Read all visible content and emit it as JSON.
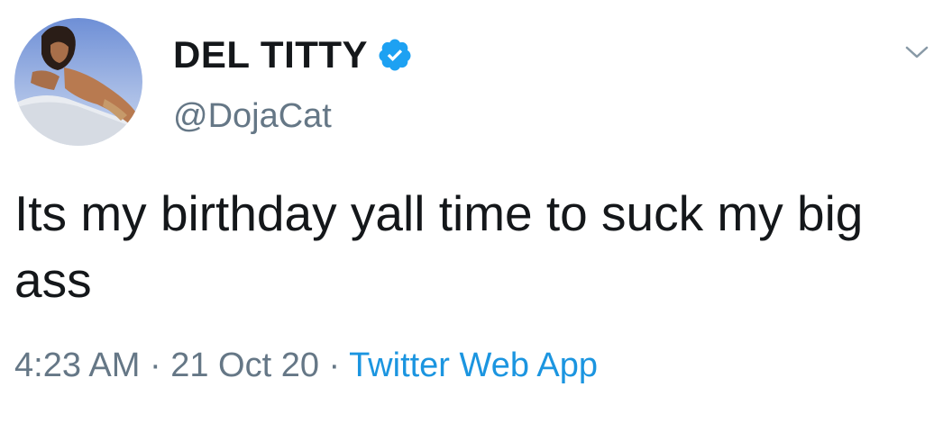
{
  "user": {
    "display_name": "DEL TITTY",
    "handle": "@DojaCat",
    "verified": true
  },
  "tweet": {
    "text": "Its my birthday yall time to suck my big ass"
  },
  "meta": {
    "time": "4:23 AM",
    "separator": " · ",
    "date": "21 Oct 20",
    "source": "Twitter Web App"
  },
  "icons": {
    "verified": "verified-badge-icon",
    "menu": "chevron-down-icon"
  },
  "colors": {
    "text": "#14171a",
    "secondary": "#657786",
    "link": "#1b95e0",
    "verified": "#1da1f2"
  }
}
